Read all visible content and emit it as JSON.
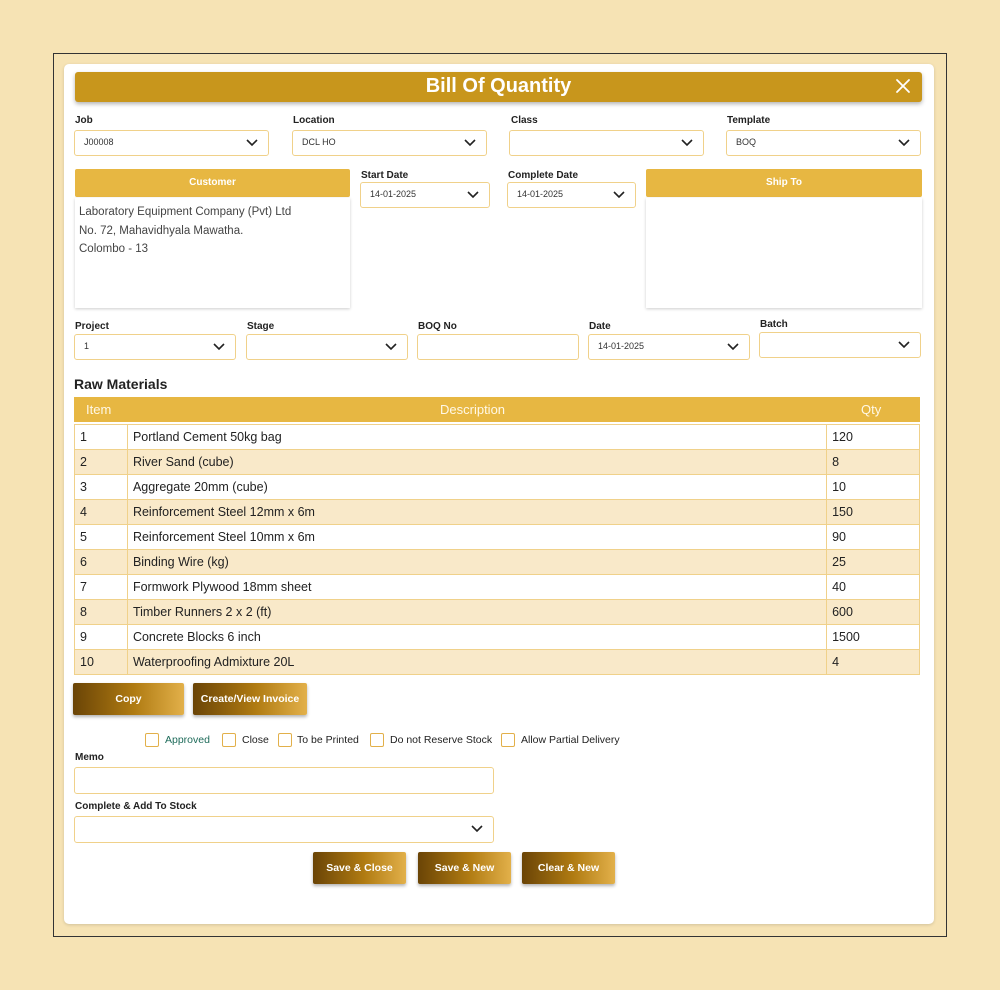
{
  "dialog": {
    "title": "Bill Of Quantity"
  },
  "header_fields": {
    "job": {
      "label": "Job",
      "value": "J00008"
    },
    "location": {
      "label": "Location",
      "value": "DCL HO"
    },
    "class": {
      "label": "Class",
      "value": ""
    },
    "template": {
      "label": "Template",
      "value": "BOQ"
    },
    "start_date": {
      "label": "Start Date",
      "value": "14-01-2025"
    },
    "complete_date": {
      "label": "Complete Date",
      "value": "14-01-2025"
    }
  },
  "customer": {
    "header": "Customer",
    "address": [
      "Laboratory Equipment Company (Pvt) Ltd",
      "No. 72, Mahavidhyala Mawatha.",
      "Colombo - 13"
    ]
  },
  "ship_to": {
    "header": "Ship To"
  },
  "project_fields": {
    "project": {
      "label": "Project",
      "value": "1"
    },
    "stage": {
      "label": "Stage",
      "value": ""
    },
    "boq_no": {
      "label": "BOQ No",
      "value": ""
    },
    "date": {
      "label": "Date",
      "value": "14-01-2025"
    },
    "batch": {
      "label": "Batch",
      "value": ""
    }
  },
  "raw_materials": {
    "title": "Raw Materials",
    "columns": [
      "Item",
      "Description",
      "Qty"
    ],
    "rows": [
      [
        "1",
        "Portland Cement 50kg bag",
        "120"
      ],
      [
        "2",
        "River Sand (cube)",
        "8"
      ],
      [
        "3",
        "Aggregate 20mm (cube)",
        "10"
      ],
      [
        "4",
        "Reinforcement Steel 12mm x 6m",
        "150"
      ],
      [
        "5",
        "Reinforcement Steel 10mm x 6m",
        "90"
      ],
      [
        "6",
        "Binding Wire (kg)",
        "25"
      ],
      [
        "7",
        "Formwork Plywood 18mm sheet",
        "40"
      ],
      [
        "8",
        "Timber Runners 2 x 2 (ft)",
        "600"
      ],
      [
        "9",
        "Concrete Blocks 6 inch",
        "1500"
      ],
      [
        "10",
        "Waterproofing Admixture 20L",
        "4"
      ]
    ]
  },
  "actions": {
    "copy": "Copy",
    "invoice": "Create/View Invoice"
  },
  "checkboxes": {
    "approved": "Approved",
    "close": "Close",
    "to_be_printed": "To be Printed",
    "no_reserve": "Do not Reserve Stock",
    "partial_delivery": "Allow Partial Delivery"
  },
  "memo": {
    "label": "Memo",
    "value": ""
  },
  "complete_add": {
    "label": "Complete & Add To Stock",
    "value": ""
  },
  "footer": {
    "save_close": "Save & Close",
    "save_new": "Save & New",
    "clear_new": "Clear & New"
  },
  "colors": {
    "title_bar": "#c8961c",
    "panel_header": "#e7b742",
    "field_border": "#f0d18a",
    "approved_text": "#1e6b5a"
  },
  "icons": {
    "close": "close-icon",
    "dropdown": "chevron-down-icon"
  }
}
